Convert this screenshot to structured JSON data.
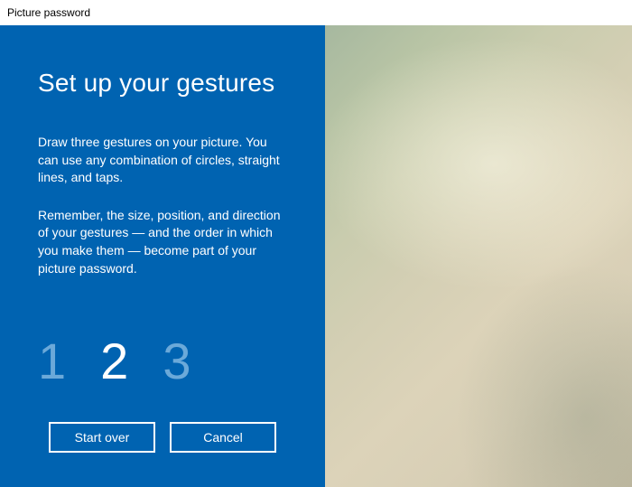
{
  "window": {
    "title": "Picture password"
  },
  "panel": {
    "heading": "Set up your gestures",
    "paragraph1": "Draw three gestures on your picture. You can use any combination of circles, straight lines, and taps.",
    "paragraph2": "Remember, the size, position, and direction of your gestures — and the order in which you make them — become part of your picture password.",
    "steps": {
      "one": "1",
      "two": "2",
      "three": "3",
      "active_index": 1
    },
    "buttons": {
      "start_over": "Start over",
      "cancel": "Cancel"
    }
  },
  "colors": {
    "panel_bg": "#0063b1",
    "step_inactive": "#6ba9d9",
    "step_active": "#ffffff"
  }
}
